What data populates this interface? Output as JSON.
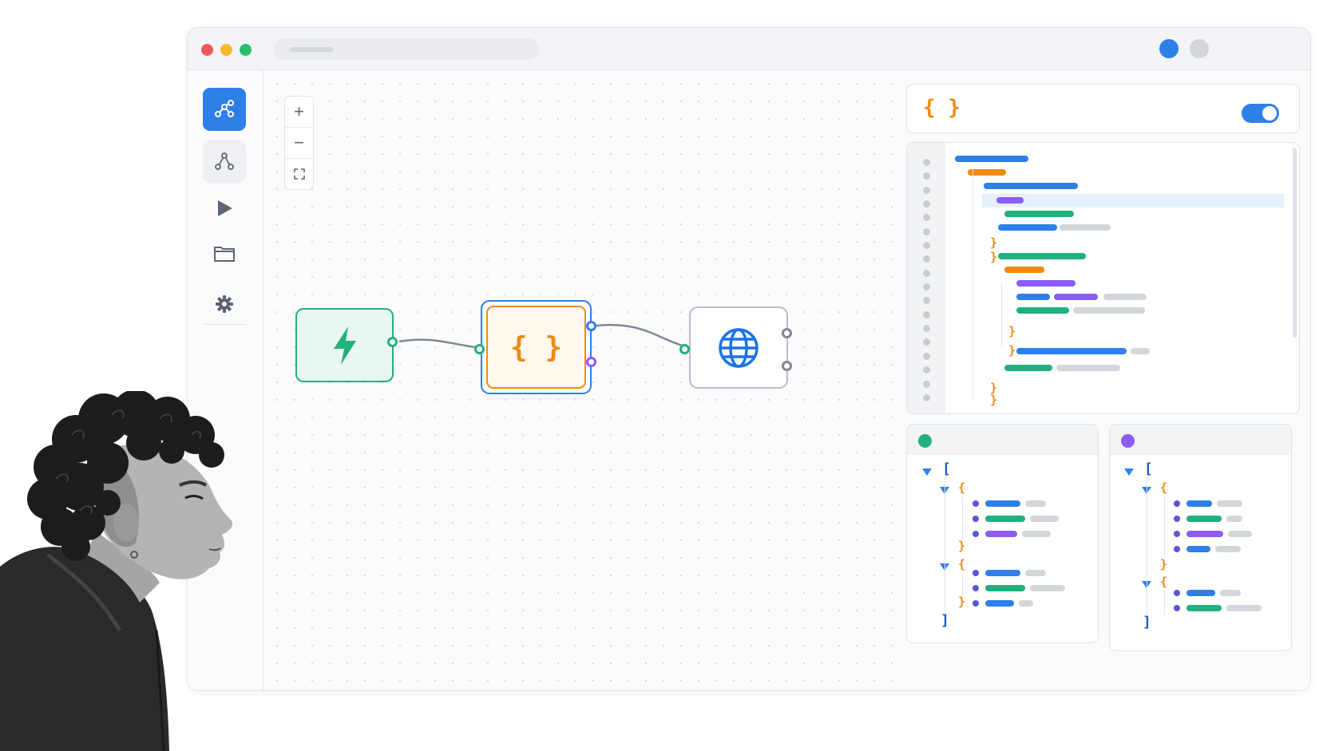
{
  "window": {
    "traffic_lights": [
      "#ef5b5b",
      "#f5b92e",
      "#2dbd6e"
    ],
    "avatars": [
      "#2f7fe8",
      "#d3d6db"
    ]
  },
  "sidebar": {
    "items": [
      {
        "icon": "workflow-icon",
        "active": true
      },
      {
        "icon": "nodes-graph-icon",
        "active": false
      },
      {
        "icon": "play-icon",
        "active": false
      },
      {
        "icon": "folder-icon",
        "active": false
      },
      {
        "icon": "gear-icon",
        "active": false
      }
    ]
  },
  "canvas": {
    "zoom_controls": [
      {
        "label": "+",
        "icon": "zoom-in-icon"
      },
      {
        "label": "−",
        "icon": "zoom-out-icon"
      },
      {
        "label": "⛶",
        "icon": "fit-view-icon"
      }
    ],
    "nodes": [
      {
        "type": "trigger",
        "icon": "lightning-icon",
        "color": "#22b07d"
      },
      {
        "type": "transform",
        "icon": "braces-icon",
        "label": "{ }",
        "color": "#f08a12",
        "selected": true
      },
      {
        "type": "http",
        "icon": "globe-icon",
        "color": "#1a73e8"
      }
    ]
  },
  "inspector": {
    "header_icon": "{ }",
    "toggle_on": true,
    "code_braces": [
      "}",
      "}",
      "}",
      "}",
      "}",
      "}"
    ],
    "input_preview": {
      "status_color": "#22b07d",
      "open_bracket": "[",
      "close_bracket": "]",
      "open_brace": "{",
      "close_brace": "}"
    },
    "output_preview": {
      "status_color": "#8b5cf6",
      "open_bracket": "[",
      "close_bracket": "]",
      "open_brace": "{",
      "close_brace": "}"
    }
  },
  "colors": {
    "accent": "#2f7fe8",
    "green": "#22b07d",
    "orange": "#f08a12",
    "purple": "#8b5cf6",
    "gray": "#d3d6db"
  }
}
